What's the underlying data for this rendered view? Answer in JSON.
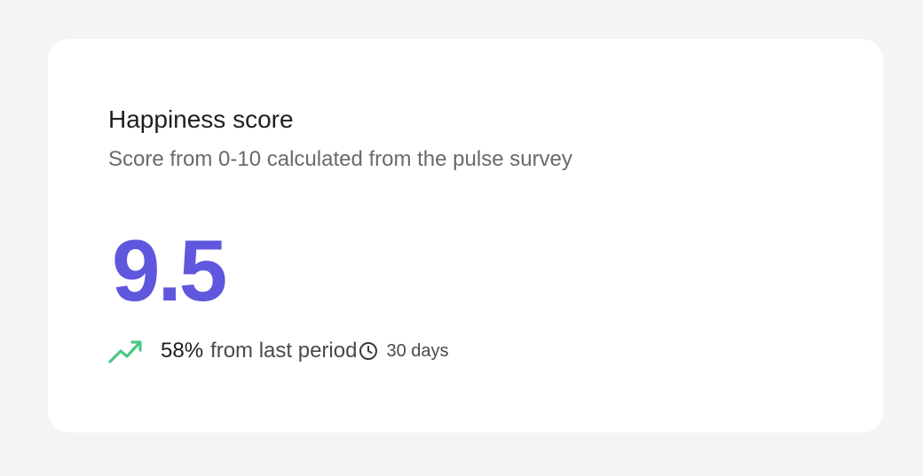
{
  "card": {
    "title": "Happiness score",
    "subtitle": "Score from 0-10 calculated from the pulse survey",
    "score": "9.5",
    "change_value": "58%",
    "change_text": "from last period",
    "period": "30 days"
  },
  "icons": {
    "trend": "trending-up-icon",
    "clock": "clock-icon"
  },
  "colors": {
    "accent": "#5f57dd",
    "trend_up": "#4cc784"
  }
}
